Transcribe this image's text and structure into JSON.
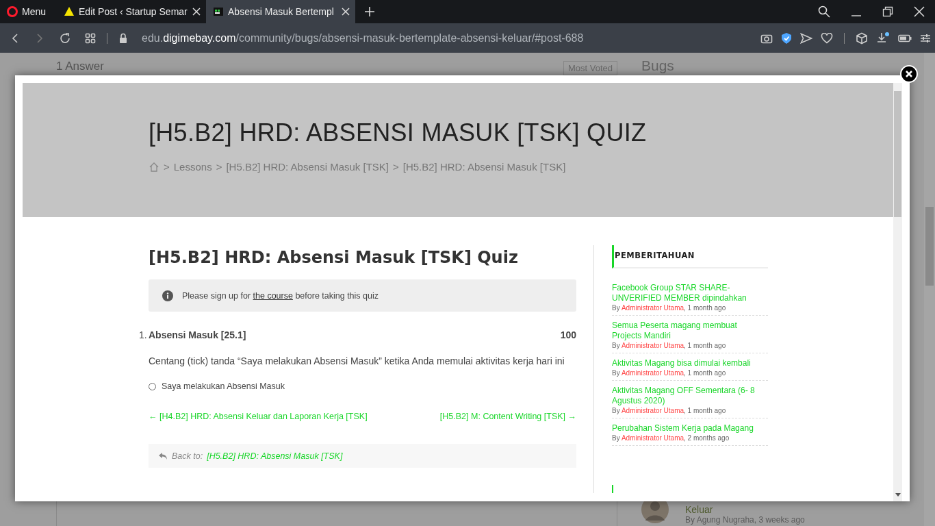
{
  "browser": {
    "menu_label": "Menu",
    "tabs": [
      {
        "kind": "warning",
        "label": "Edit Post ‹ Startup Semar",
        "selected": false
      },
      {
        "kind": "site",
        "label": "Absensi Masuk Bertempl",
        "selected": true
      }
    ],
    "address": "edu.**digimebay.com**/community/bugs/absensi-masuk-bertemplate-absensi-keluar/#post-688"
  },
  "background_page": {
    "answers_heading": "1 Answer",
    "sort": "Most Voted",
    "sidebar_title": "Bugs",
    "activity": {
      "title": "Keluar",
      "byline": "By Agung Nugraha, 3 weeks ago"
    }
  },
  "modal": {
    "hero": {
      "title": "[H5.B2] HRD: ABSENSI MASUK [TSK] QUIZ",
      "breadcrumb": [
        "Lessons",
        "[H5.B2] HRD: Absensi Masuk [TSK]",
        "[H5.B2] HRD: Absensi Masuk [TSK]"
      ],
      "separator": ">"
    },
    "quiz": {
      "title": "[H5.B2] HRD: Absensi Masuk [TSK] Quiz",
      "notice": {
        "before": "Please sign up for",
        "link": "the course",
        "after": "before taking this quiz"
      },
      "questions": [
        {
          "number": "1.",
          "title": "Absensi Masuk [25.1]",
          "points": "100",
          "text": "Centang (tick) tanda “Saya melakukan Absensi Masuk” ketika Anda memulai aktivitas kerja hari ini",
          "options": [
            {
              "label": "Saya melakukan Absensi Masuk",
              "selected": false
            }
          ]
        }
      ],
      "prev": "← [H4.B2] HRD: Absensi Keluar dan Laporan Kerja [TSK]",
      "next": "[H5.B2] M: Content Writing [TSK] →",
      "back": {
        "label": "Back to:",
        "link": "[H5.B2] HRD: Absensi Masuk [TSK]"
      }
    },
    "sidebar": {
      "title": "PEMBERITAHUAN",
      "posts": [
        {
          "title": "Facebook Group STAR SHARE-UNVERIFIED MEMBER dipindahkan",
          "by": "By",
          "author": "Administrator Utama",
          "time": ", 1 month ago"
        },
        {
          "title": "Semua Peserta magang membuat Projects Mandiri",
          "by": "By",
          "author": "Administrator Utama",
          "time": ", 1 month ago"
        },
        {
          "title": "Aktivitas Magang bisa dimulai kembali",
          "by": "By",
          "author": "Administrator Utama",
          "time": ", 1 month ago"
        },
        {
          "title": "Aktivitas Magang OFF Sementara (6- 8 Agustus 2020)",
          "by": "By",
          "author": "Administrator Utama",
          "time": ", 1 month ago"
        },
        {
          "title": "Perubahan Sistem Kerja pada Magang",
          "by": "By",
          "author": "Administrator Utama",
          "time": ", 2 months ago"
        }
      ]
    }
  }
}
